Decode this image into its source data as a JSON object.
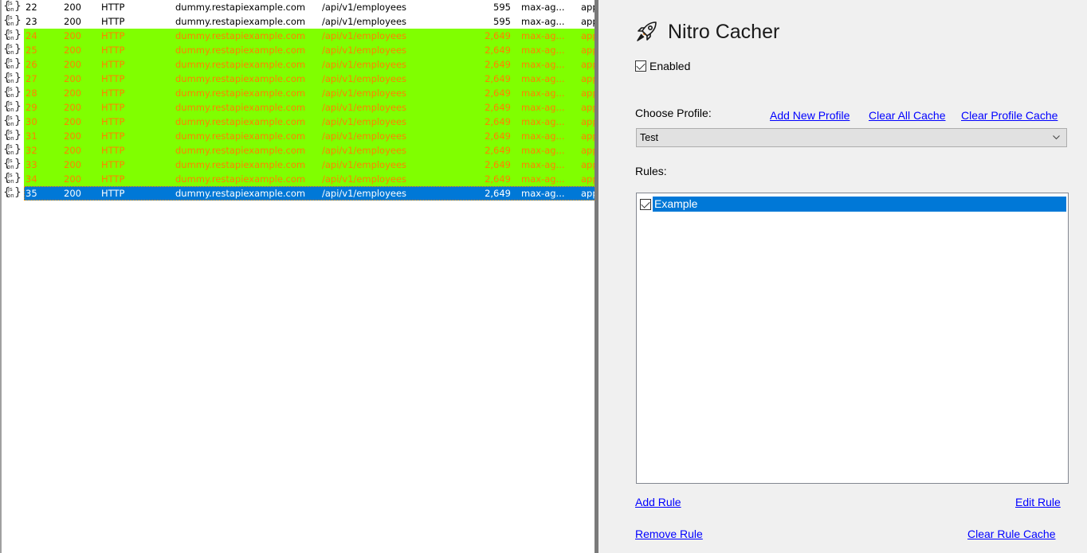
{
  "sessions": {
    "rows": [
      {
        "num": "22",
        "result": "200",
        "protocol": "HTTP",
        "host": "dummy.restapiexample.com",
        "url": "/api/v1/employees",
        "body": "595",
        "caching": "max-ag...",
        "content_type": "app",
        "state": "normal"
      },
      {
        "num": "23",
        "result": "200",
        "protocol": "HTTP",
        "host": "dummy.restapiexample.com",
        "url": "/api/v1/employees",
        "body": "595",
        "caching": "max-ag...",
        "content_type": "app",
        "state": "normal"
      },
      {
        "num": "24",
        "result": "200",
        "protocol": "HTTP",
        "host": "dummy.restapiexample.com",
        "url": "/api/v1/employees",
        "body": "2,649",
        "caching": "max-ag...",
        "content_type": "app",
        "state": "cached"
      },
      {
        "num": "25",
        "result": "200",
        "protocol": "HTTP",
        "host": "dummy.restapiexample.com",
        "url": "/api/v1/employees",
        "body": "2,649",
        "caching": "max-ag...",
        "content_type": "app",
        "state": "cached"
      },
      {
        "num": "26",
        "result": "200",
        "protocol": "HTTP",
        "host": "dummy.restapiexample.com",
        "url": "/api/v1/employees",
        "body": "2,649",
        "caching": "max-ag...",
        "content_type": "app",
        "state": "cached"
      },
      {
        "num": "27",
        "result": "200",
        "protocol": "HTTP",
        "host": "dummy.restapiexample.com",
        "url": "/api/v1/employees",
        "body": "2,649",
        "caching": "max-ag...",
        "content_type": "app",
        "state": "cached"
      },
      {
        "num": "28",
        "result": "200",
        "protocol": "HTTP",
        "host": "dummy.restapiexample.com",
        "url": "/api/v1/employees",
        "body": "2,649",
        "caching": "max-ag...",
        "content_type": "app",
        "state": "cached"
      },
      {
        "num": "29",
        "result": "200",
        "protocol": "HTTP",
        "host": "dummy.restapiexample.com",
        "url": "/api/v1/employees",
        "body": "2,649",
        "caching": "max-ag...",
        "content_type": "app",
        "state": "cached"
      },
      {
        "num": "30",
        "result": "200",
        "protocol": "HTTP",
        "host": "dummy.restapiexample.com",
        "url": "/api/v1/employees",
        "body": "2,649",
        "caching": "max-ag...",
        "content_type": "app",
        "state": "cached"
      },
      {
        "num": "31",
        "result": "200",
        "protocol": "HTTP",
        "host": "dummy.restapiexample.com",
        "url": "/api/v1/employees",
        "body": "2,649",
        "caching": "max-ag...",
        "content_type": "app",
        "state": "cached"
      },
      {
        "num": "32",
        "result": "200",
        "protocol": "HTTP",
        "host": "dummy.restapiexample.com",
        "url": "/api/v1/employees",
        "body": "2,649",
        "caching": "max-ag...",
        "content_type": "app",
        "state": "cached"
      },
      {
        "num": "33",
        "result": "200",
        "protocol": "HTTP",
        "host": "dummy.restapiexample.com",
        "url": "/api/v1/employees",
        "body": "2,649",
        "caching": "max-ag...",
        "content_type": "app",
        "state": "cached"
      },
      {
        "num": "34",
        "result": "200",
        "protocol": "HTTP",
        "host": "dummy.restapiexample.com",
        "url": "/api/v1/employees",
        "body": "2,649",
        "caching": "max-ag...",
        "content_type": "app",
        "state": "cached"
      },
      {
        "num": "35",
        "result": "200",
        "protocol": "HTTP",
        "host": "dummy.restapiexample.com",
        "url": "/api/v1/employees",
        "body": "2,649",
        "caching": "max-ag...",
        "content_type": "app",
        "state": "selected"
      }
    ],
    "row_icon": "json-icon",
    "colors": {
      "cached_bg": "#80ff00",
      "cached_text": "#ff8000",
      "selected_bg": "#0078d7"
    }
  },
  "panel": {
    "title": "Nitro Cacher",
    "title_icon": "rocket-icon",
    "enabled_label": "Enabled",
    "enabled_checked": true,
    "choose_profile_label": "Choose Profile:",
    "links": {
      "add_new_profile": "Add New Profile",
      "clear_all_cache": "Clear All Cache",
      "clear_profile_cache": "Clear Profile Cache"
    },
    "profile_selected": "Test",
    "rules_label": "Rules:",
    "rules": [
      {
        "label": "Example",
        "checked": true,
        "selected": true
      }
    ],
    "actions": {
      "add_rule": "Add Rule",
      "edit_rule": "Edit Rule",
      "remove_rule": "Remove Rule",
      "clear_rule_cache": "Clear Rule Cache"
    }
  }
}
